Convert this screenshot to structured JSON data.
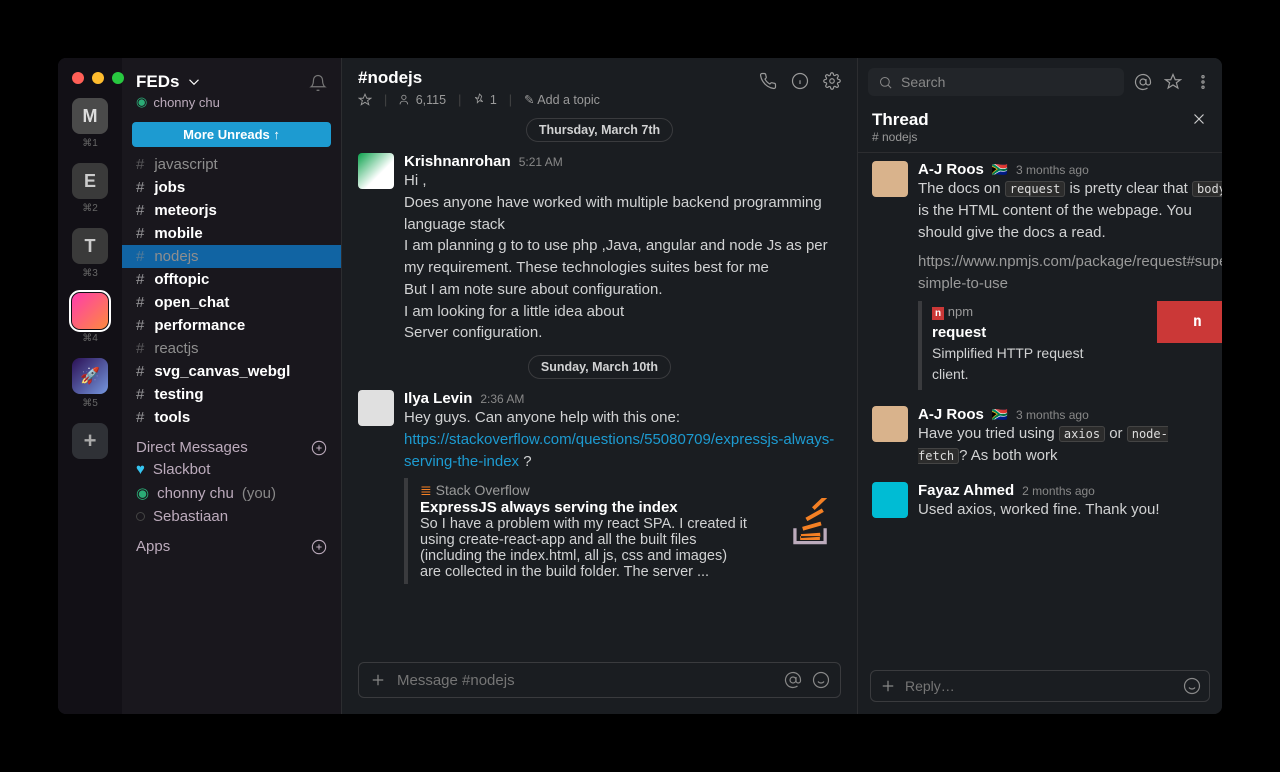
{
  "workspaces": [
    {
      "id": "M",
      "letter": "M",
      "shortcut": "⌘1"
    },
    {
      "id": "E",
      "letter": "E",
      "shortcut": "⌘2"
    },
    {
      "id": "T",
      "letter": "T",
      "shortcut": "⌘3"
    },
    {
      "id": "F",
      "letter": "",
      "shortcut": "⌘4",
      "active": true
    },
    {
      "id": "R",
      "letter": "",
      "shortcut": "⌘5"
    }
  ],
  "sidebar": {
    "team": "FEDs",
    "user": "chonny chu",
    "more_unreads": "More Unreads  ↑",
    "channels": [
      {
        "name": "javascript",
        "style": "muted"
      },
      {
        "name": "jobs",
        "style": "bold"
      },
      {
        "name": "meteorjs",
        "style": "bold"
      },
      {
        "name": "mobile",
        "style": "bold"
      },
      {
        "name": "nodejs",
        "style": "active"
      },
      {
        "name": "offtopic",
        "style": "bold"
      },
      {
        "name": "open_chat",
        "style": "bold"
      },
      {
        "name": "performance",
        "style": "bold"
      },
      {
        "name": "reactjs",
        "style": "muted"
      },
      {
        "name": "svg_canvas_webgl",
        "style": "bold"
      },
      {
        "name": "testing",
        "style": "bold"
      },
      {
        "name": "tools",
        "style": "bold"
      }
    ],
    "dm_header": "Direct Messages",
    "dms": [
      {
        "name": "Slackbot",
        "icon": "heart"
      },
      {
        "name": "chonny chu",
        "suffix": "(you)",
        "icon": "presence-active"
      },
      {
        "name": "Sebastiaan",
        "icon": "presence-away"
      }
    ],
    "apps_header": "Apps"
  },
  "channel": {
    "title": "#nodejs",
    "members": "6,115",
    "pins": "1",
    "topic_cta": "Add a topic"
  },
  "messages": {
    "date1": "Thursday, March 7th",
    "m1": {
      "author": "Krishnanrohan",
      "ts": "5:21 AM",
      "line1": "Hi ,",
      "line2": "Does anyone have worked with multiple backend programming language stack",
      "line3": "I am planning g to to use php ,Java, angular and node Js as per my requirement. These technologies suites best for me",
      "line4": "But I am note sure about configuration.",
      "line5": "I am looking for a little idea about",
      "line6": "Server configuration."
    },
    "date2": "Sunday, March 10th",
    "m2": {
      "author": "Ilya Levin",
      "ts": "2:36 AM",
      "line1": "Hey guys. Can anyone help with this one:",
      "link": "https://stackoverflow.com/questions/55080709/expressjs-always-serving-the-index",
      "link_suffix": " ?",
      "attach_site": "Stack Overflow",
      "attach_title": "ExpressJS always serving the index",
      "attach_desc": "So I have a problem with my react SPA. I created it using create-react-app and all the built files (including the index.html, all js, css and images) are collected in the build folder. The server ..."
    }
  },
  "composer": {
    "placeholder": "Message #nodejs"
  },
  "search": {
    "placeholder": "Search"
  },
  "thread": {
    "title": "Thread",
    "sub": "# nodejs",
    "t1": {
      "author": "A-J Roos",
      "flag": "🇿🇦",
      "ts": "3 months ago",
      "p1a": "The docs on ",
      "code1": "request",
      "p1b": " is pretty clear that ",
      "code2": "body",
      "p1c": " is the HTML content of the webpage. You should give the docs a read.",
      "url": "https://www.npmjs.com/package/request#super-simple-to-use",
      "lp_src": "npm",
      "lp_title": "request",
      "lp_desc": "Simplified HTTP request client."
    },
    "t2": {
      "author": "A-J Roos",
      "flag": "🇿🇦",
      "ts": "3 months ago",
      "p1a": "Have you tried using ",
      "code1": "axios",
      "p1b": " or ",
      "code2": "node-fetch",
      "p1c": "? As both work"
    },
    "t3": {
      "author": "Fayaz Ahmed",
      "ts": "2 months ago",
      "text": "Used axios, worked fine. Thank you!"
    },
    "reply_placeholder": "Reply…"
  }
}
